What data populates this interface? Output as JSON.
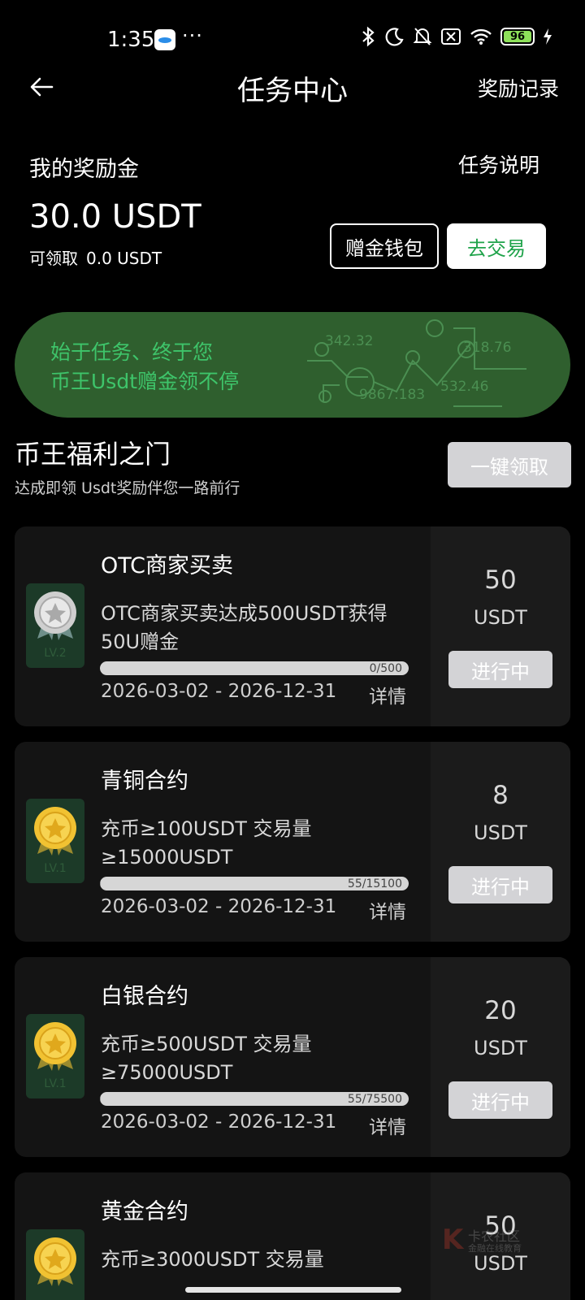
{
  "status_bar": {
    "time": "1:35",
    "dots": "···",
    "battery": "96"
  },
  "nav": {
    "title": "任务中心",
    "right_link": "奖励记录"
  },
  "reward": {
    "label": "我的奖励金",
    "task_desc_link": "任务说明",
    "amount": "30.0 USDT",
    "claimable_label": "可领取",
    "claimable_value": "0.0 USDT",
    "wallet_button": "赠金钱包",
    "trade_button": "去交易"
  },
  "banner": {
    "line1": "始于任务、终于您",
    "line2": "币王Usdt赠金领不停",
    "numbers": [
      "342.32",
      "318.76",
      "532.46",
      "9867.183"
    ]
  },
  "section": {
    "title": "币王福利之门",
    "subtitle": "达成即领 Usdt奖励伴您一路前行",
    "claim_all_button": "一键领取"
  },
  "tasks": [
    {
      "title": "OTC商家买卖",
      "description": "OTC商家买卖达成500USDT获得50U赠金",
      "progress_text": "0/500",
      "progress_fraction": 0,
      "date_range": "2026-03-02 - 2026-12-31",
      "detail_link": "详情",
      "reward_amount": "50",
      "reward_unit": "USDT",
      "status": "进行中",
      "badge_level": "LV.2",
      "badge_type": "silver-medal-icon"
    },
    {
      "title": "青铜合约",
      "description": "充币≥100USDT 交易量≥15000USDT",
      "progress_text": "55/15100",
      "progress_fraction": 0.0036,
      "date_range": "2026-03-02 - 2026-12-31",
      "detail_link": "详情",
      "reward_amount": "8",
      "reward_unit": "USDT",
      "status": "进行中",
      "badge_level": "LV.1",
      "badge_type": "gold-medal-icon"
    },
    {
      "title": "白银合约",
      "description": "充币≥500USDT 交易量≥75000USDT",
      "progress_text": "55/75500",
      "progress_fraction": 0.0007,
      "date_range": "2026-03-02 - 2026-12-31",
      "detail_link": "详情",
      "reward_amount": "20",
      "reward_unit": "USDT",
      "status": "进行中",
      "badge_level": "LV.1",
      "badge_type": "gold-medal-icon"
    },
    {
      "title": "黄金合约",
      "description": "充币≥3000USDT 交易量",
      "reward_amount": "50",
      "reward_unit": "USDT",
      "badge_type": "gold-medal-icon"
    }
  ],
  "watermark": {
    "mark": "K",
    "line1": "卡农社区",
    "line2": "金融在线教育"
  }
}
